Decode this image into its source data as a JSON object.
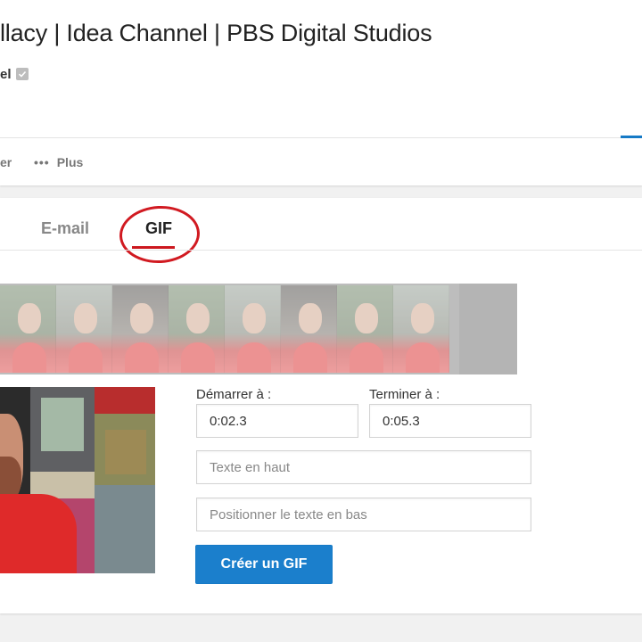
{
  "video": {
    "title": "llacy | Idea Channel | PBS Digital Studios",
    "channel_name": "el"
  },
  "actions": {
    "partial_label": "er",
    "more_dots": "•••",
    "more_label": "Plus"
  },
  "share": {
    "tabs": [
      {
        "label": "E-mail",
        "active": false
      },
      {
        "label": "GIF",
        "active": true
      }
    ],
    "gif": {
      "start_label": "Démarrer à :",
      "start_value": "0:02.3",
      "end_label": "Terminer à :",
      "end_value": "0:05.3",
      "top_text_placeholder": "Texte en haut",
      "bottom_text_placeholder": "Positionner le texte en bas",
      "create_button_label": "Créer un GIF"
    }
  },
  "colors": {
    "accent_blue": "#167ac6",
    "button_blue": "#1b7fcc",
    "tab_underline_red": "#cc181e",
    "annotation_red": "#d11a21"
  }
}
